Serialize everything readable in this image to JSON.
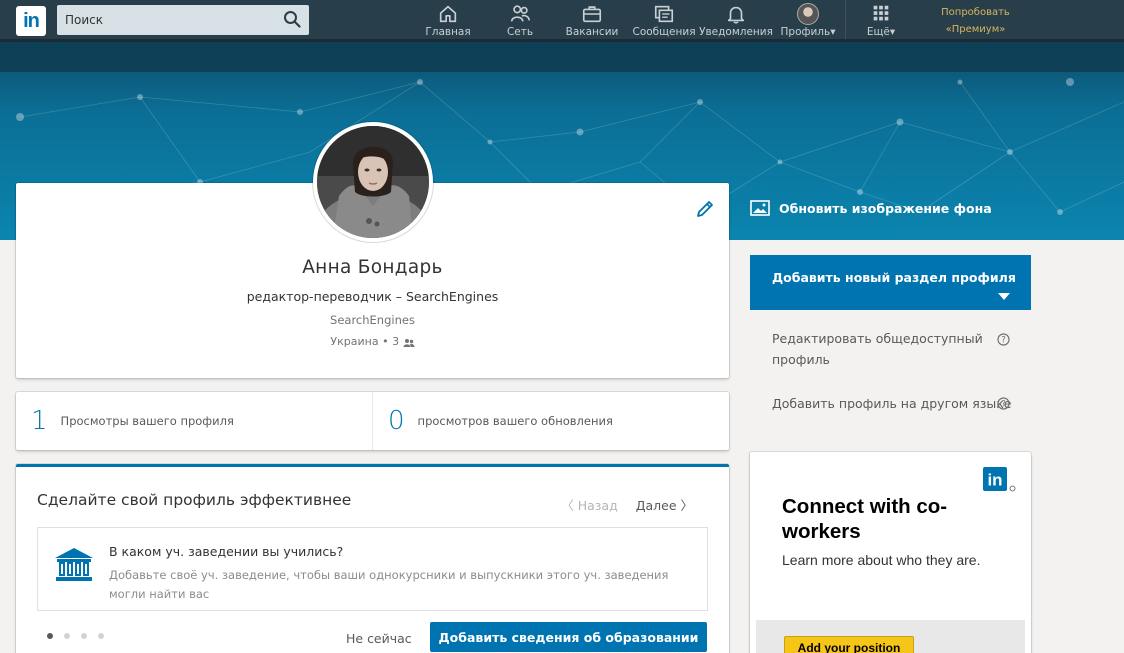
{
  "nav": {
    "logo_text": "in",
    "search_placeholder": "Поиск",
    "items": [
      {
        "label": "Главная",
        "icon": "home-icon"
      },
      {
        "label": "Сеть",
        "icon": "network-icon"
      },
      {
        "label": "Вакансии",
        "icon": "briefcase-icon"
      },
      {
        "label": "Сообщения",
        "icon": "messages-icon"
      },
      {
        "label": "Уведомления",
        "icon": "bell-icon"
      },
      {
        "label": "Профиль▾",
        "icon": "avatar"
      },
      {
        "label": "Ещё▾",
        "icon": "grid-icon"
      }
    ],
    "premium_line1": "Попробовать",
    "premium_line2": "«Премиум» бесплатно"
  },
  "banner": {
    "update_bg_label": "Обновить изображение фона"
  },
  "profile": {
    "name": "Анна Бондарь",
    "headline": "редактор-переводчик – SearchEngines",
    "company": "SearchEngines",
    "location": "Украина",
    "connections": "3"
  },
  "stats": [
    {
      "value": "1",
      "label": "Просмотры вашего профиля"
    },
    {
      "value": "0",
      "label": "просмотров вашего обновления"
    }
  ],
  "strength": {
    "title": "Сделайте свой профиль эффективнее",
    "back_label": "Назад",
    "next_label": "Далее",
    "suggestion_title": "В каком уч. заведении вы учились?",
    "suggestion_text": "Добавьте своё уч. заведение, чтобы ваши однокурсники и выпускники этого уч. заведения могли найти вас",
    "not_now_label": "Не сейчас",
    "add_button_label": "Добавить сведения об образовании",
    "dots_total": 4,
    "dots_active": 1
  },
  "rail": {
    "add_section_label": "Добавить новый раздел профиля",
    "edit_public_label": "Редактировать общедоступный профиль",
    "add_language_label": "Добавить профиль на другом языке"
  },
  "ad": {
    "logo_text": "in",
    "title": "Connect with co-workers",
    "subtitle": "Learn more about who they are.",
    "button_label": "Add your position"
  },
  "colors": {
    "brand": "#0073b1",
    "nav_bg": "#283e4a",
    "premium_gold": "#d9b55f"
  }
}
